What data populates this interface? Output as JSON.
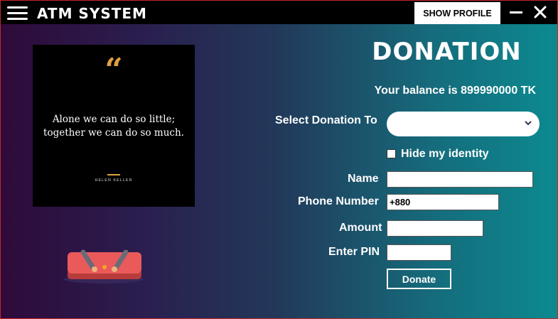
{
  "window": {
    "title": "ATM SYSTEM",
    "show_profile_label": "SHOW PROFILE",
    "border_color": "#c62828",
    "titlebar_color": "#000000",
    "gradient_colors": [
      "#2e0a3a",
      "#22395a",
      "#0c8a90"
    ]
  },
  "quote_card": {
    "quote_mark": "“",
    "quote_line1": "Alone we can do so little;",
    "quote_line2": "together we can do so much.",
    "author": "HELEN KELLER",
    "accent_color": "#e0a040"
  },
  "icons": {
    "menu": "hamburger-menu-icon",
    "minimize": "minimize-icon",
    "close": "close-icon",
    "dropdown": "chevron-down-icon",
    "illustration": "donate-button-illustration"
  },
  "donation": {
    "title": "DONATION",
    "balance_text": "Your balance is 899990000 TK",
    "select_label": "Select Donation To",
    "select_value": "",
    "hide_identity_label": "Hide my identity",
    "hide_identity_checked": false,
    "name_label": "Name",
    "name_value": "",
    "phone_label": "Phone Number",
    "phone_value": "+880",
    "amount_label": "Amount",
    "amount_value": "",
    "pin_label": "Enter PIN",
    "pin_value": "",
    "donate_label": "Donate"
  }
}
